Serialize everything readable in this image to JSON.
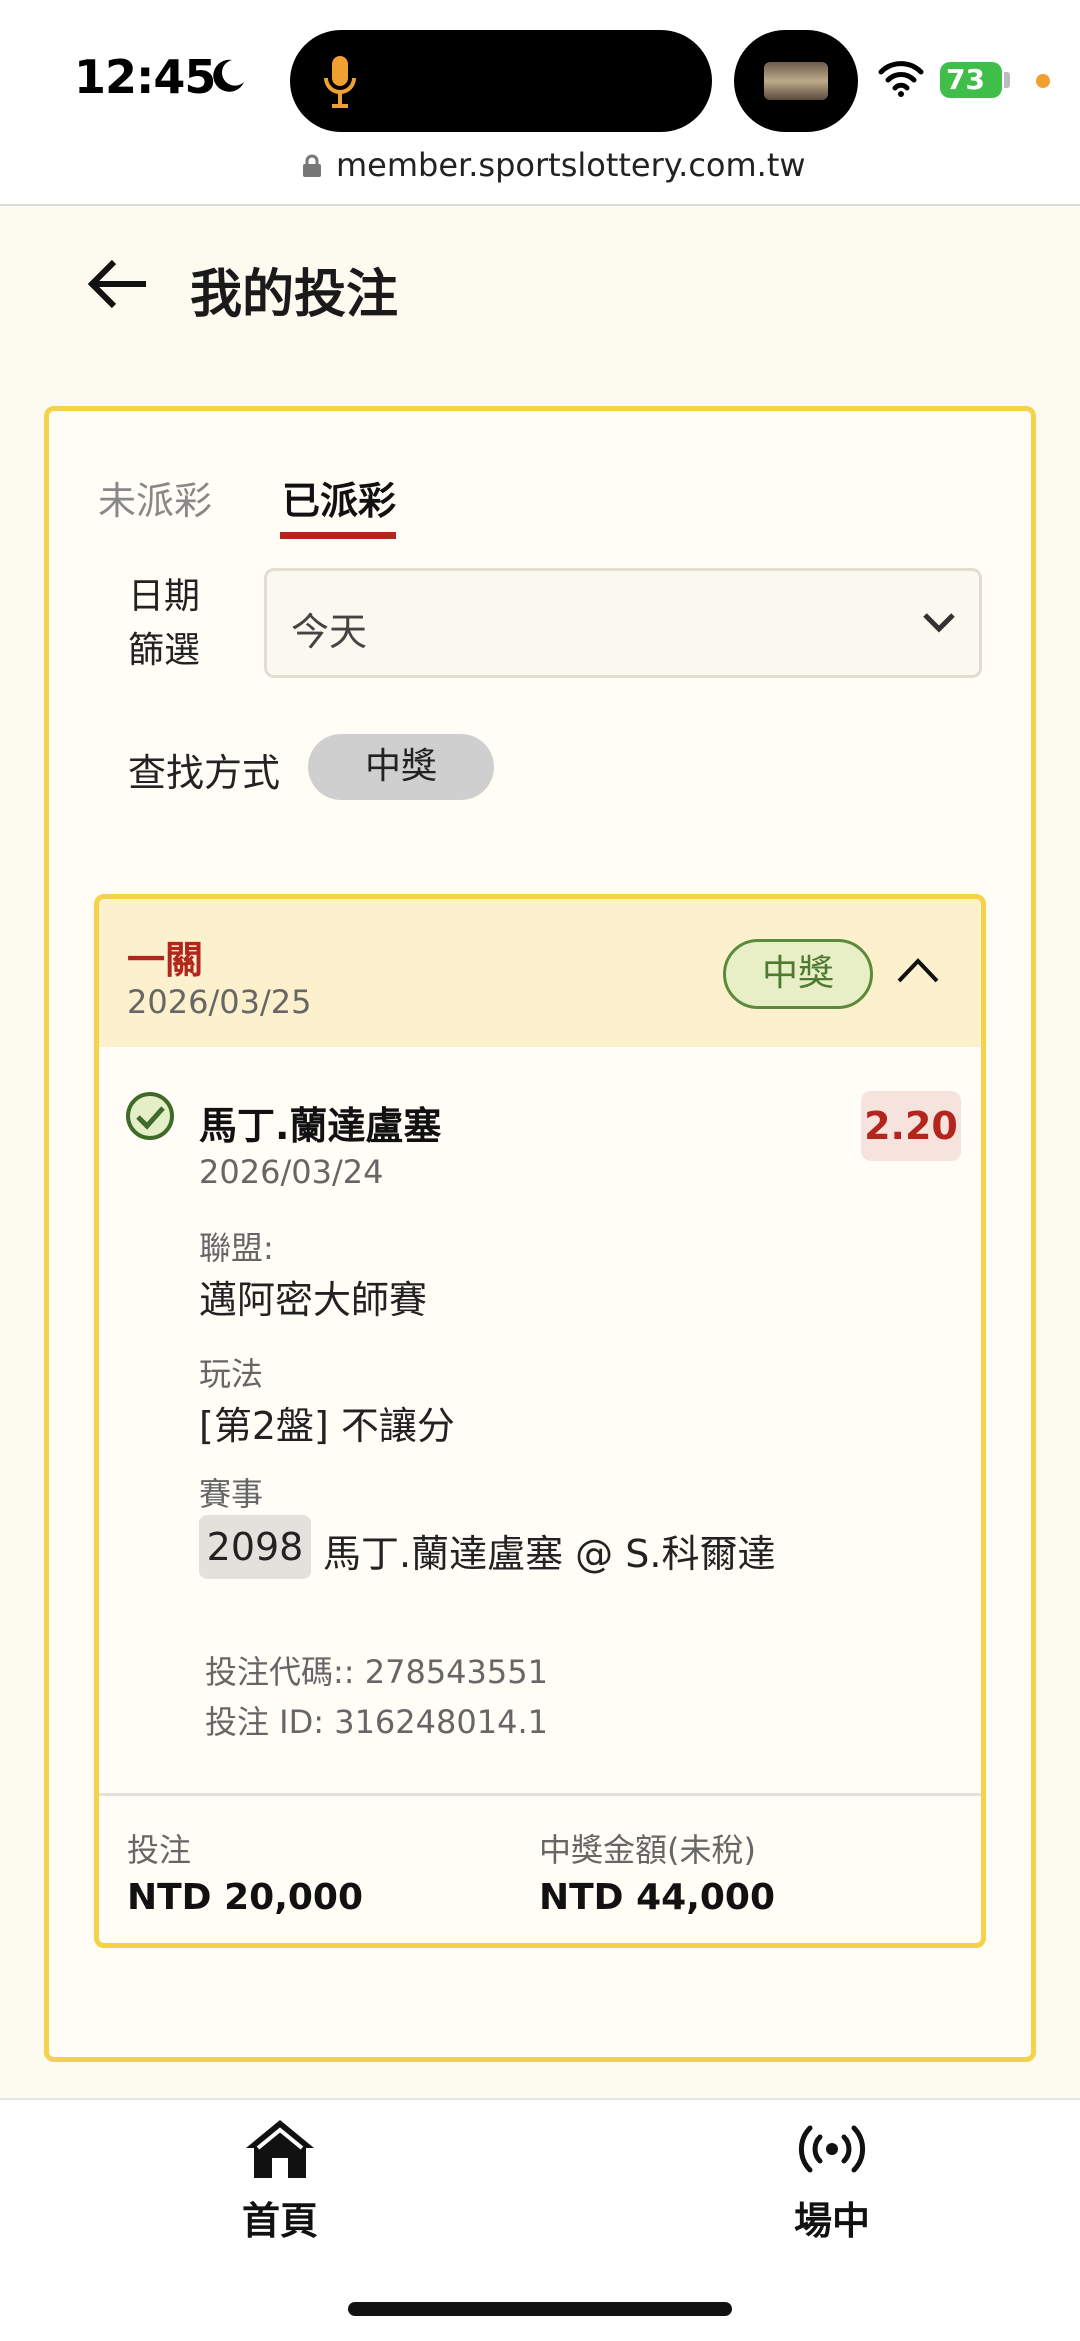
{
  "status_bar": {
    "time": "12:45",
    "battery": "73",
    "url": "member.sportslottery.com.tw"
  },
  "header": {
    "title": "我的投注"
  },
  "tabs": {
    "unpaid": "未派彩",
    "paid": "已派彩",
    "active": "paid"
  },
  "filters": {
    "date_label_line1": "日期",
    "date_label_line2": "篩選",
    "date_value": "今天",
    "search_label": "查找方式",
    "search_chip": "中獎"
  },
  "bet": {
    "type": "一關",
    "date": "2026/03/25",
    "result_badge": "中獎",
    "selection": {
      "player": "馬丁.蘭達盧塞",
      "match_date": "2026/03/24",
      "odds": "2.20",
      "league_label": "聯盟:",
      "league": "邁阿密大師賽",
      "play_label": "玩法",
      "play": "[第2盤] 不讓分",
      "event_label": "賽事",
      "event_code": "2098",
      "event_name": "馬丁.蘭達盧塞 @ S.科爾達"
    },
    "bet_code": "投注代碼:: 278543551",
    "bet_id": "投注 ID: 316248014.1",
    "stake_label": "投注",
    "stake_value": "NTD 20,000",
    "payout_label": "中獎金額(未稅)",
    "payout_value": "NTD 44,000"
  },
  "bottom_nav": {
    "home": "首頁",
    "live": "場中"
  },
  "colors": {
    "accent_red": "#b3261e",
    "border_yellow": "#f4d34a",
    "win_green": "#4d7a2f"
  }
}
